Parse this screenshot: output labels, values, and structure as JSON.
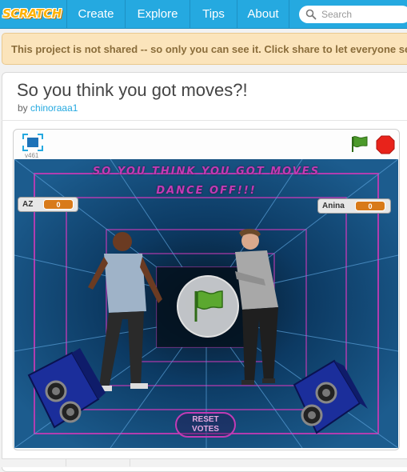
{
  "nav": {
    "logo": "SCRATCH",
    "items": [
      "Create",
      "Explore",
      "Tips",
      "About"
    ],
    "search_placeholder": "Search"
  },
  "banner": {
    "text": "This project is not shared -- so only you can see it. Click share to let everyone see it!"
  },
  "project": {
    "title": "So you think you got moves?!",
    "by_label": "by",
    "author": "chinoraaa1",
    "version": "v461"
  },
  "stage": {
    "title_line1": "SO YOU THINK YOU GOT MOVES",
    "title_line2": "DANCE OFF!!!",
    "monitors": [
      {
        "label": "AZ",
        "value": "0"
      },
      {
        "label": "Anina",
        "value": "0"
      }
    ],
    "reset_label_1": "RESET",
    "reset_label_2": "VOTES"
  },
  "colors": {
    "nav_bg": "#25a9e0",
    "banner_bg": "#fbe4bb",
    "banner_text": "#8a6d3b",
    "link": "#25a9e0",
    "stage_accent": "#c23bb5",
    "flag_green": "#4c9a2a",
    "stop_red": "#e8231b"
  },
  "icons": [
    "search-icon",
    "fullscreen-icon",
    "green-flag-icon",
    "stop-icon"
  ]
}
